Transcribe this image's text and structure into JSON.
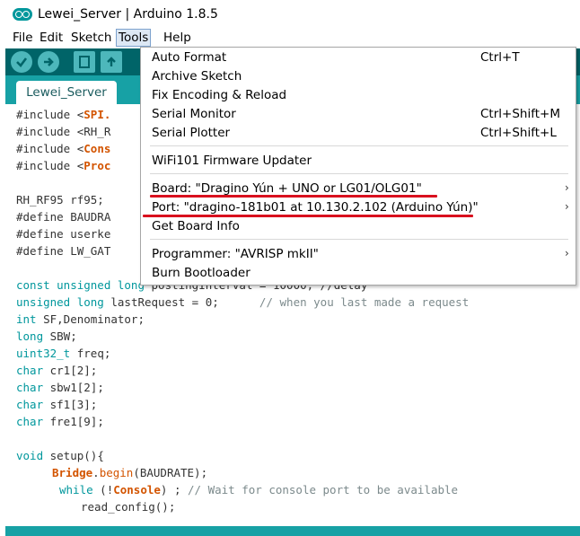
{
  "window": {
    "title": "Lewei_Server | Arduino 1.8.5"
  },
  "menubar": {
    "items": [
      "File",
      "Edit",
      "Sketch",
      "Tools",
      "Help"
    ]
  },
  "toolbar": {
    "buttons": [
      "verify-icon",
      "upload-icon",
      "new-icon",
      "open-icon"
    ]
  },
  "tabs": [
    {
      "label": "Lewei_Server"
    }
  ],
  "editor": {
    "lines": {
      "l1a": "#include <",
      "l1b": "SPI.",
      "l2": "#include <RH_R",
      "l3a": "#include <",
      "l3b": "Cons",
      "l4a": "#include <",
      "l4b": "Proc",
      "l6": "RH_RF95 rf95;",
      "l7": "#define BAUDRA",
      "l8": "#define userke",
      "l9": "#define LW_GAT",
      "l10a": "const unsigned long",
      "l10b": " postingInterval = 10000; //delay",
      "l11a": "unsigned long",
      "l11b": " lastRequest = 0;",
      "l11c": "      // when you last made a request",
      "l12a": "int",
      "l12b": " SF,Denominator;",
      "l13a": "long",
      "l13b": " SBW;",
      "l14a": "uint32_t",
      "l14b": " freq;",
      "l15a": "char",
      "l15b": " cr1[2];",
      "l16a": "char",
      "l16b": " sbw1[2];",
      "l17a": "char",
      "l17b": " sf1[3];",
      "l18a": "char",
      "l18b": " fre1[9];",
      "l20a": "void",
      "l20b": " setup(){",
      "l21a": "Bridge",
      "l21b": ".",
      "l21c": "begin",
      "l21d": "(BAUDRATE);",
      "l22a": "while",
      "l22b": " (!",
      "l22c": "Console",
      "l22d": ") ; ",
      "l22e": "// Wait for console port to be available",
      "l23": "read_config();"
    }
  },
  "tools_menu": {
    "items": [
      {
        "label": "Auto Format",
        "shortcut": "Ctrl+T"
      },
      {
        "label": "Archive Sketch"
      },
      {
        "label": "Fix Encoding & Reload"
      },
      {
        "label": "Serial Monitor",
        "shortcut": "Ctrl+Shift+M"
      },
      {
        "label": "Serial Plotter",
        "shortcut": "Ctrl+Shift+L"
      },
      {
        "label": "WiFi101 Firmware Updater"
      },
      {
        "label": "Board: \"Dragino Yún + UNO or LG01/OLG01\"",
        "submenu_arrow": "›"
      },
      {
        "label": "Port: \"dragino-181b01 at 10.130.2.102 (Arduino Yún)\"",
        "submenu_arrow": "›"
      },
      {
        "label": "Get Board Info"
      },
      {
        "label": "Programmer: \"AVRISP mkII\"",
        "submenu_arrow": "›"
      },
      {
        "label": "Burn Bootloader"
      }
    ]
  },
  "colors": {
    "toolbar": "#006468",
    "tabstrip": "#17a1a5",
    "keyword": "#00979c",
    "function": "#d35400",
    "annotation_underline": "#d9101e"
  }
}
